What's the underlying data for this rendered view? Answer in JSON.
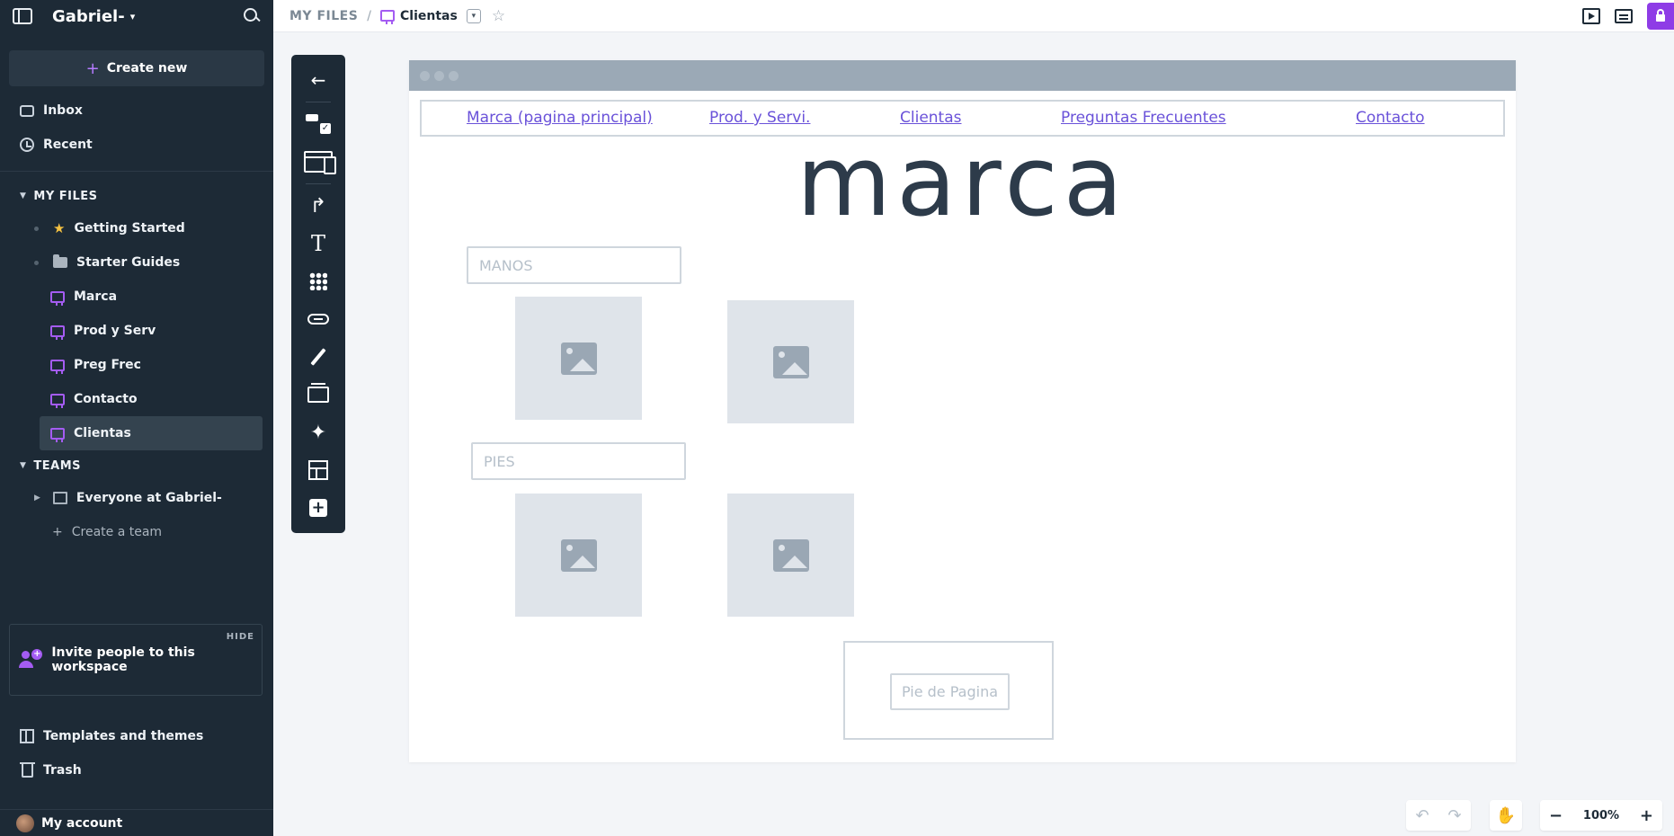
{
  "sidebar": {
    "workspace": "Gabriel-",
    "create_new": "Create new",
    "nav": [
      {
        "label": "Inbox",
        "icon": "inbox-icon"
      },
      {
        "label": "Recent",
        "icon": "clock-icon"
      }
    ],
    "my_files_title": "MY FILES",
    "files": [
      {
        "label": "Getting Started",
        "icon": "star-icon"
      },
      {
        "label": "Starter Guides",
        "icon": "folder-icon"
      },
      {
        "label": "Marca",
        "icon": "board-icon"
      },
      {
        "label": "Prod y Serv",
        "icon": "board-icon"
      },
      {
        "label": "Preg Frec",
        "icon": "board-icon"
      },
      {
        "label": "Contacto",
        "icon": "board-icon"
      },
      {
        "label": "Clientas",
        "icon": "board-icon",
        "active": true
      }
    ],
    "teams_title": "TEAMS",
    "team": "Everyone at Gabriel-",
    "create_team": "Create a team",
    "invite": {
      "hide": "HIDE",
      "text": "Invite people to this workspace"
    },
    "templates": "Templates and themes",
    "trash": "Trash",
    "account": "My account"
  },
  "topbar": {
    "root": "MY FILES",
    "separator": "/",
    "file": "Clientas",
    "accent": "#8e3ce6"
  },
  "canvas": {
    "nav_links": [
      "Marca (pagina principal)",
      "Prod. y Servi.",
      "Clientas",
      "Preguntas Frecuentes",
      "Contacto"
    ],
    "brand": "marca",
    "section1": "MANOS",
    "section2": "PIES",
    "footer": "Pie de Pagina",
    "link_color": "#6a52d9"
  },
  "zoom": {
    "value": "100%",
    "minus": "−",
    "plus": "+"
  }
}
